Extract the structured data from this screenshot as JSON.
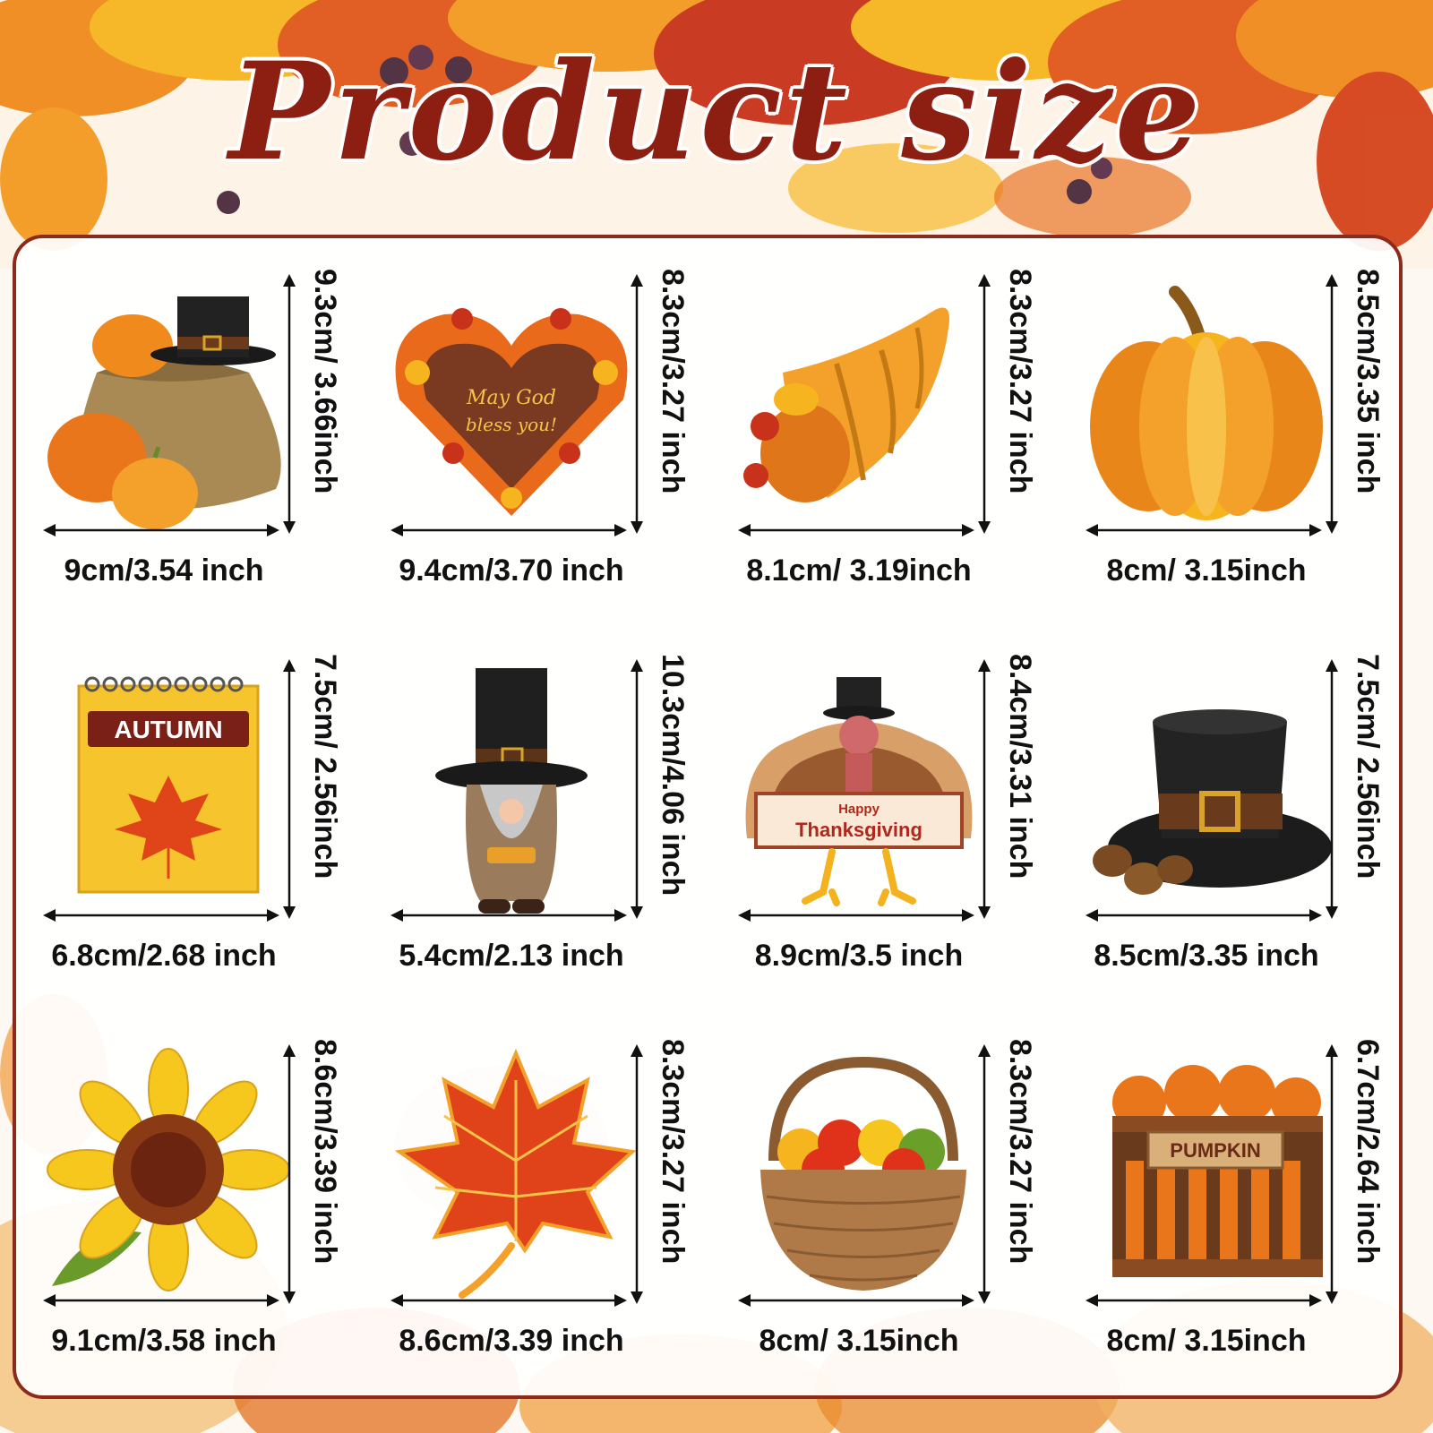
{
  "title": "Product size",
  "colors": {
    "title": "#8c1e12",
    "border": "#8c2a1b",
    "leaf_orange": "#f08a1c",
    "leaf_red": "#c8321a",
    "leaf_yellow": "#f6b51e",
    "text": "#111111"
  },
  "items": [
    {
      "name": "pumpkin-sack",
      "width": "9cm/3.54 inch",
      "height": "9.3cm/ 3.66inch"
    },
    {
      "name": "leaf-heart-sign",
      "width": "9.4cm/3.70 inch",
      "height": "8.3cm/3.27 inch",
      "sign_text_1": "May God",
      "sign_text_2": "bless you!"
    },
    {
      "name": "cornucopia",
      "width": "8.1cm/ 3.19inch",
      "height": "8.3cm/3.27 inch"
    },
    {
      "name": "pumpkin",
      "width": "8cm/ 3.15inch",
      "height": "8.5cm/3.35 inch"
    },
    {
      "name": "autumn-calendar",
      "width": "6.8cm/2.68 inch",
      "height": "7.5cm/ 2.56inch",
      "calendar_text": "AUTUMN"
    },
    {
      "name": "pilgrim-gnome",
      "width": "5.4cm/2.13 inch",
      "height": "10.3cm/4.06 inch"
    },
    {
      "name": "thanksgiving-turkey",
      "width": "8.9cm/3.5 inch",
      "height": "8.4cm/3.31 inch",
      "sign_text_1": "Happy",
      "sign_text_2": "Thanksgiving"
    },
    {
      "name": "pilgrim-hat",
      "width": "8.5cm/3.35 inch",
      "height": "7.5cm/ 2.56inch"
    },
    {
      "name": "sunflower",
      "width": "9.1cm/3.58 inch",
      "height": "8.6cm/3.39 inch"
    },
    {
      "name": "maple-leaf",
      "width": "8.6cm/3.39 inch",
      "height": "8.3cm/3.27 inch"
    },
    {
      "name": "apple-basket",
      "width": "8cm/ 3.15inch",
      "height": "8.3cm/3.27 inch"
    },
    {
      "name": "pumpkin-crate",
      "width": "8cm/ 3.15inch",
      "height": "6.7cm/2.64 inch",
      "crate_text": "PUMPKIN"
    }
  ]
}
